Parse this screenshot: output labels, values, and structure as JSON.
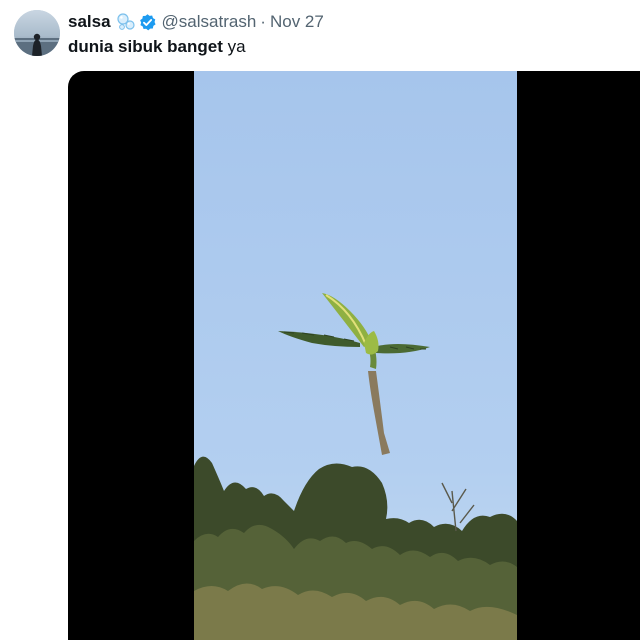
{
  "tweet": {
    "author": {
      "display_name": "salsa",
      "name_emoji": "bubbles-icon",
      "verified": true,
      "handle": "@salsatrash",
      "separator": "·",
      "time": "Nov 27",
      "avatar": "silhouette-at-seaside-avatar"
    },
    "text": {
      "bold": "dunia sibuk banget",
      "plain": " ya"
    },
    "media": {
      "type": "video",
      "description_icon": "banana-tree-flying-frame"
    }
  },
  "colors": {
    "text_primary": "#0f1419",
    "text_secondary": "#536471",
    "verified_blue": "#1d9bf0",
    "media_letterbox": "#000000",
    "sky": "#a9c7ec"
  }
}
